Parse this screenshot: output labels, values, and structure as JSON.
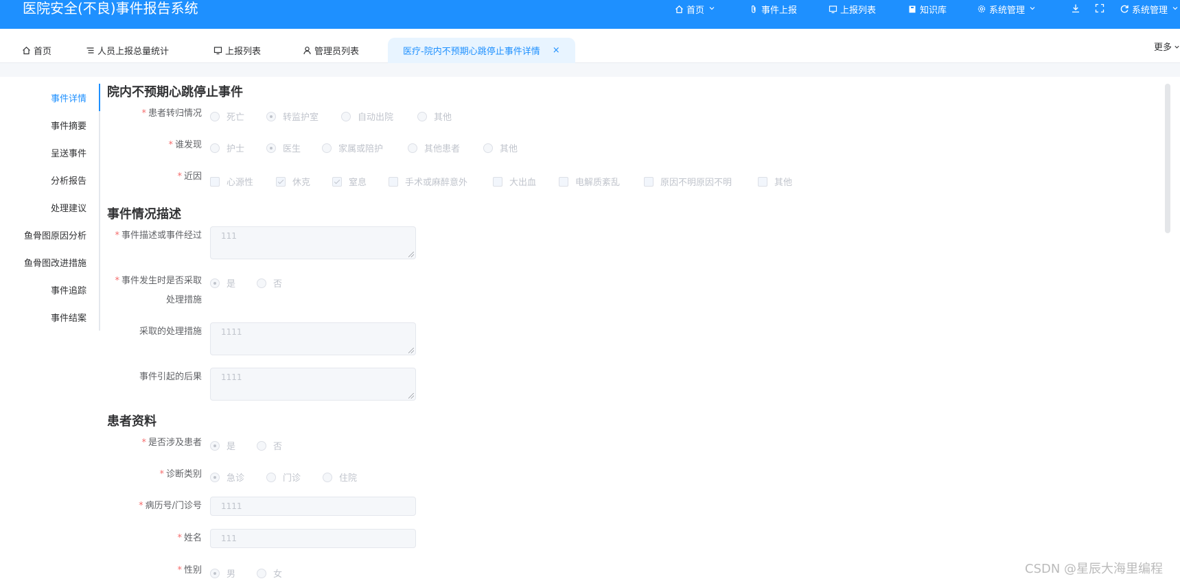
{
  "app_title": "医院安全(不良)事件报告系统",
  "topnav": {
    "home": "首页",
    "report": "事件上报",
    "report_list": "上报列表",
    "knowledge": "知识库",
    "system": "系统管理",
    "system2": "系统管理"
  },
  "tabs": {
    "home": "首页",
    "stats": "人员上报总量统计",
    "report_list": "上报列表",
    "admin_list": "管理员列表",
    "active": "医疗-院内不预期心跳停止事件详情",
    "close": "×",
    "more": "更多"
  },
  "anchor_nav": [
    "事件详情",
    "事件摘要",
    "呈送事件",
    "分析报告",
    "处理建议",
    "鱼骨图原因分析",
    "鱼骨图改进措施",
    "事件追踪",
    "事件结案"
  ],
  "sections": {
    "event": "院内不预期心跳停止事件",
    "desc": "事件情况描述",
    "patient": "患者资料"
  },
  "fields": {
    "outcome": {
      "label": "患者转归情况",
      "options": [
        "死亡",
        "转监护室",
        "自动出院",
        "其他"
      ],
      "selected": "转监护室"
    },
    "discoverer": {
      "label": "谁发现",
      "options": [
        "护士",
        "医生",
        "家属或陪护",
        "其他患者",
        "其他"
      ],
      "selected": "医生"
    },
    "cause": {
      "label": "近因",
      "options": [
        "心源性",
        "休克",
        "窒息",
        "手术或麻醉意外",
        "大出血",
        "电解质紊乱",
        "原因不明原因不明",
        "其他"
      ],
      "checked": [
        "休克",
        "窒息"
      ]
    },
    "description": {
      "label": "事件描述或事件经过",
      "value": "111"
    },
    "measures_taken": {
      "label_line1": "事件发生时是否采取",
      "label_line2": "处理措施",
      "options": [
        "是",
        "否"
      ],
      "selected": "是"
    },
    "measures": {
      "label": "采取的处理措施",
      "value": "1111"
    },
    "consequence": {
      "label": "事件引起的后果",
      "value": "1111"
    },
    "involves_patient": {
      "label": "是否涉及患者",
      "options": [
        "是",
        "否"
      ],
      "selected": "是"
    },
    "diag_type": {
      "label": "诊断类别",
      "options": [
        "急诊",
        "门诊",
        "住院"
      ],
      "selected": "急诊"
    },
    "record_no": {
      "label": "病历号/门诊号",
      "value": "1111"
    },
    "name": {
      "label": "姓名",
      "value": "111"
    },
    "gender": {
      "label": "性别",
      "options": [
        "男",
        "女"
      ],
      "selected": "男"
    }
  },
  "required_mark": "*",
  "watermark": "CSDN @星辰大海里编程"
}
